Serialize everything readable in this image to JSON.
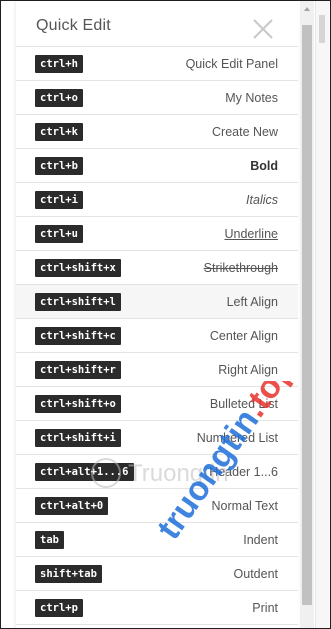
{
  "panel": {
    "title": "Quick Edit"
  },
  "shortcuts": [
    {
      "keys": "ctrl+h",
      "label": "Quick Edit Panel",
      "style": ""
    },
    {
      "keys": "ctrl+o",
      "label": "My Notes",
      "style": ""
    },
    {
      "keys": "ctrl+k",
      "label": "Create New",
      "style": ""
    },
    {
      "keys": "ctrl+b",
      "label": "Bold",
      "style": "bold"
    },
    {
      "keys": "ctrl+i",
      "label": "Italics",
      "style": "italic"
    },
    {
      "keys": "ctrl+u",
      "label": "Underline",
      "style": "underline"
    },
    {
      "keys": "ctrl+shift+x",
      "label": "Strikethrough",
      "style": "strike"
    },
    {
      "keys": "ctrl+shift+l",
      "label": "Left Align",
      "style": ""
    },
    {
      "keys": "ctrl+shift+c",
      "label": "Center Align",
      "style": ""
    },
    {
      "keys": "ctrl+shift+r",
      "label": "Right Align",
      "style": ""
    },
    {
      "keys": "ctrl+shift+o",
      "label": "Bulleted List",
      "style": ""
    },
    {
      "keys": "ctrl+shift+i",
      "label": "Numbered List",
      "style": ""
    },
    {
      "keys": "ctrl+alt+1...6",
      "label": "Header 1...6",
      "style": ""
    },
    {
      "keys": "ctrl+alt+0",
      "label": "Normal Text",
      "style": ""
    },
    {
      "keys": "tab",
      "label": "Indent",
      "style": ""
    },
    {
      "keys": "shift+tab",
      "label": "Outdent",
      "style": ""
    },
    {
      "keys": "ctrl+p",
      "label": "Print",
      "style": ""
    }
  ],
  "watermark": {
    "text": "truongtin.top",
    "logo_text": "Truongtin"
  },
  "colors": {
    "kbd_bg": "#2b2b2b",
    "watermark_red": "#e8322b",
    "watermark_blue": "#1e6fd9"
  }
}
